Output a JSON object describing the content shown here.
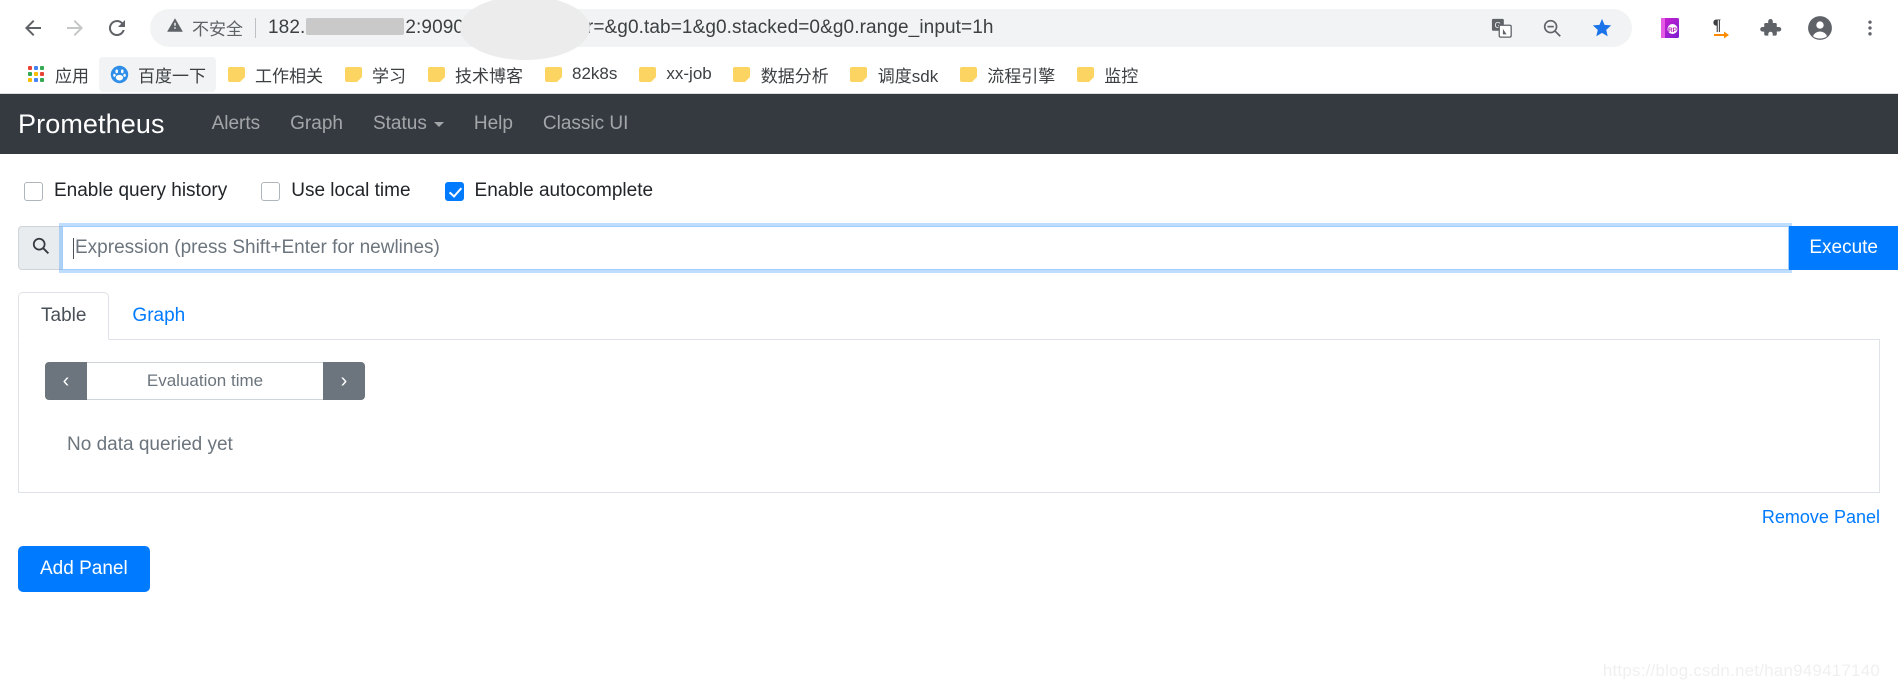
{
  "browser": {
    "nav": {
      "back_icon": "arrow-left-icon",
      "forward_icon": "arrow-right-icon",
      "reload_icon": "reload-icon"
    },
    "omnibox": {
      "security_label": "不安全",
      "security_icon": "warning-triangle-icon",
      "url_prefix": "182.",
      "url_suffix": "2:9090/graph?g0.expr=&g0.tab=1&g0.stacked=0&g0.range_input=1h",
      "translate_icon": "google-translate-icon",
      "zoomout_icon": "zoom-out-icon",
      "bookmark_icon": "star-icon"
    },
    "extensions": [
      {
        "name": "rp-extension-icon",
        "label": "RP"
      },
      {
        "name": "pilcrow-arrow-icon",
        "label": "¶"
      },
      {
        "name": "puzzle-extensions-icon",
        "label": ""
      },
      {
        "name": "profile-avatar-icon",
        "label": ""
      },
      {
        "name": "more-menu-icon",
        "label": ""
      }
    ],
    "bookmarks": [
      {
        "label": "应用",
        "icon": "apps-grid-icon",
        "highlight": false
      },
      {
        "label": "百度一下",
        "icon": "baidu-paw-icon",
        "highlight": true
      },
      {
        "label": "工作相关",
        "icon": "folder-icon",
        "highlight": false
      },
      {
        "label": "学习",
        "icon": "folder-icon",
        "highlight": false
      },
      {
        "label": "技术博客",
        "icon": "folder-icon",
        "highlight": false
      },
      {
        "label": "82k8s",
        "icon": "folder-icon",
        "highlight": false
      },
      {
        "label": "xx-job",
        "icon": "folder-icon",
        "highlight": false
      },
      {
        "label": "数据分析",
        "icon": "folder-icon",
        "highlight": false
      },
      {
        "label": "调度sdk",
        "icon": "folder-icon",
        "highlight": false
      },
      {
        "label": "流程引擎",
        "icon": "folder-icon",
        "highlight": false
      },
      {
        "label": "监控",
        "icon": "folder-icon",
        "highlight": false
      }
    ]
  },
  "app": {
    "brand": "Prometheus",
    "nav_items": [
      {
        "label": "Alerts",
        "dropdown": false
      },
      {
        "label": "Graph",
        "dropdown": false
      },
      {
        "label": "Status",
        "dropdown": true
      },
      {
        "label": "Help",
        "dropdown": false
      },
      {
        "label": "Classic UI",
        "dropdown": false
      }
    ],
    "options": [
      {
        "label": "Enable query history",
        "checked": false
      },
      {
        "label": "Use local time",
        "checked": false
      },
      {
        "label": "Enable autocomplete",
        "checked": true
      }
    ],
    "expression": {
      "search_icon": "search-icon",
      "value": "",
      "placeholder": "Expression (press Shift+Enter for newlines)",
      "execute_label": "Execute"
    },
    "tabs": [
      {
        "label": "Table",
        "active": true
      },
      {
        "label": "Graph",
        "active": false
      }
    ],
    "evaluation_time": {
      "prev_label": "‹",
      "next_label": "›",
      "value": "",
      "placeholder": "Evaluation time"
    },
    "result_message": "No data queried yet",
    "remove_panel_label": "Remove Panel",
    "add_panel_label": "Add Panel"
  },
  "watermark": "https://blog.csdn.net/han949417140",
  "colors": {
    "accent": "#007bff",
    "navbar": "#343a40",
    "muted": "#6c757d",
    "border": "#dee2e6"
  }
}
